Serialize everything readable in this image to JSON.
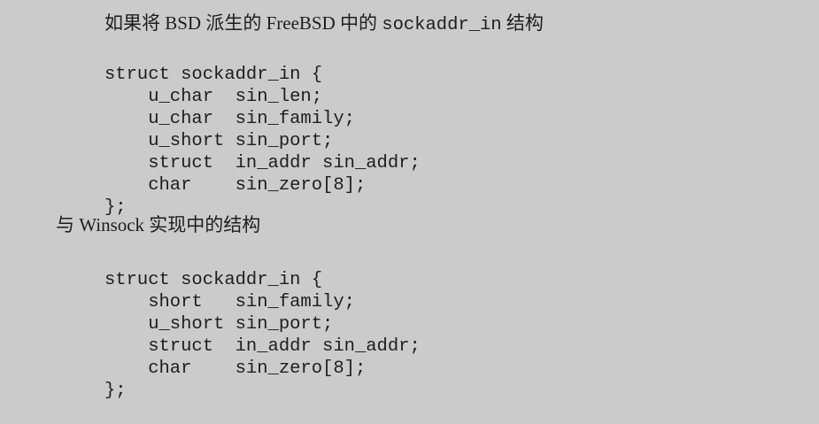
{
  "intro": {
    "prefix": "如果将 BSD 派生的 FreeBSD 中的 ",
    "code": "sockaddr_in",
    "suffix": " 结构"
  },
  "bsd_struct": [
    "struct sockaddr_in {",
    "    u_char  sin_len;",
    "    u_char  sin_family;",
    "    u_short sin_port;",
    "    struct  in_addr sin_addr;",
    "    char    sin_zero[8];",
    "};"
  ],
  "compare": {
    "text": "与 Winsock 实现中的结构"
  },
  "winsock_struct": [
    "struct sockaddr_in {",
    "    short   sin_family;",
    "    u_short sin_port;",
    "    struct  in_addr sin_addr;",
    "    char    sin_zero[8];",
    "};"
  ]
}
